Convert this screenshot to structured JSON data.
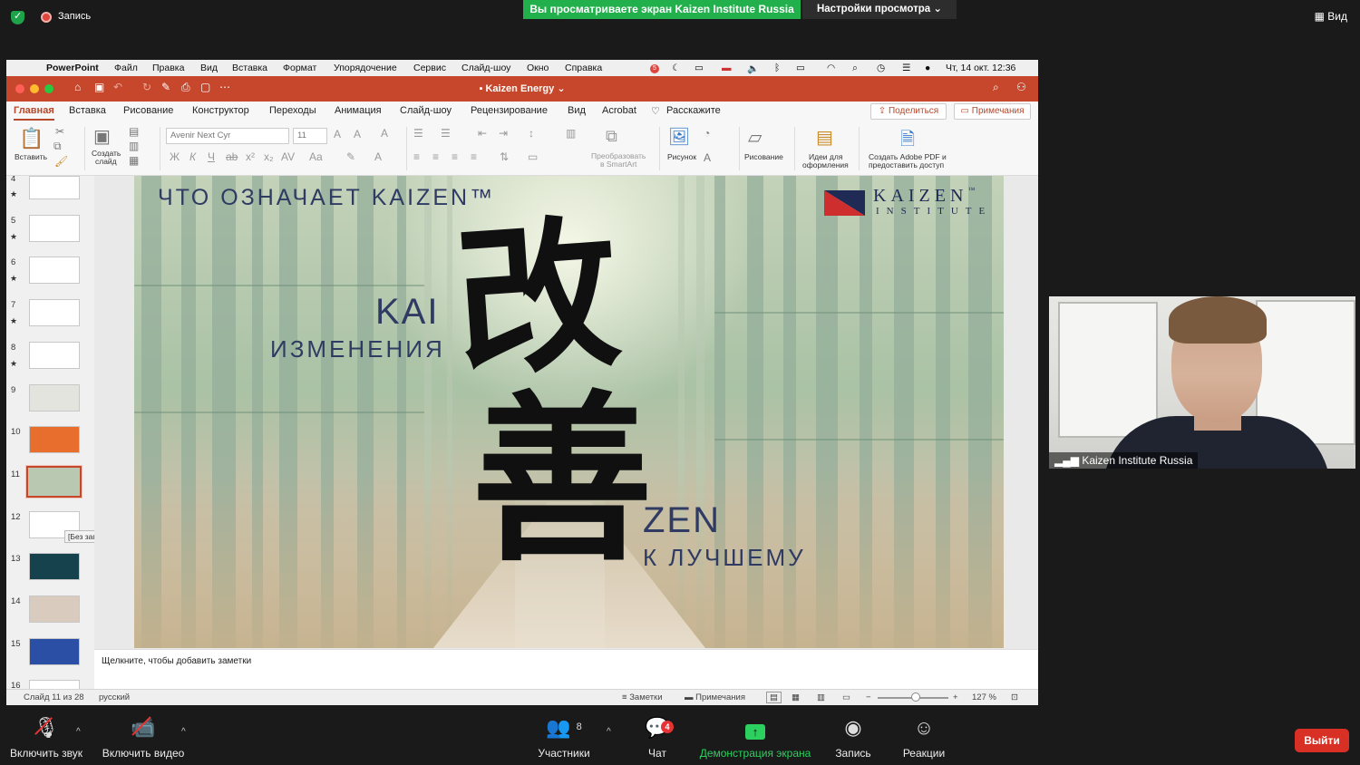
{
  "zoom_top": {
    "recording_label": "Запись",
    "viewing_banner": "Вы просматриваете экран Kaizen Institute Russia",
    "view_settings": "Настройки просмотра",
    "view_label": "Вид"
  },
  "mac_menu": {
    "app": "PowerPoint",
    "items": [
      "Файл",
      "Правка",
      "Вид",
      "Вставка",
      "Формат",
      "Упорядочение",
      "Сервис",
      "Слайд-шоу",
      "Окно",
      "Справка"
    ],
    "notif_count": "5",
    "datetime": "Чт, 14 окт.  12:36"
  },
  "ppt": {
    "doc_title": "Kaizen Energy",
    "tabs": [
      "Главная",
      "Вставка",
      "Рисование",
      "Конструктор",
      "Переходы",
      "Анимация",
      "Слайд-шоу",
      "Рецензирование",
      "Вид",
      "Acrobat",
      "Расскажите"
    ],
    "share_btn": "Поделиться",
    "comments_btn": "Примечания",
    "ribbon": {
      "paste": "Вставить",
      "new_slide_1": "Создать",
      "new_slide_2": "слайд",
      "font": "Avenir Next Cyr",
      "size": "11",
      "smartart_1": "Преобразовать",
      "smartart_2": "в SmartArt",
      "picture": "Рисунок",
      "drawing": "Рисование",
      "ideas_1": "Идеи для",
      "ideas_2": "оформления",
      "adobe_1": "Создать Adobe PDF и",
      "adobe_2": "предоставить доступ"
    },
    "thumbnails": [
      "4",
      "5",
      "6",
      "7",
      "8",
      "9",
      "10",
      "11",
      "12",
      "13",
      "14",
      "15",
      "16"
    ],
    "tooltip": "[Без заголовка]",
    "slide": {
      "title": "ЧТО ОЗНАЧАЕТ KAIZEN™",
      "logo_word": "KAIZEN",
      "logo_tm": "™",
      "logo_sub": "INSTITUTE",
      "kai": "KAI",
      "kai_meaning": "ИЗМЕНЕНИЯ",
      "zen": "ZEN",
      "zen_meaning": "К ЛУЧШЕМУ",
      "kanji_1": "改",
      "kanji_2": "善"
    },
    "notes_placeholder": "Щелкните, чтобы добавить заметки",
    "status": {
      "slide_of": "Слайд 11 из 28",
      "language": "русский",
      "notes": "Заметки",
      "comments": "Примечания",
      "zoom": "127 %"
    }
  },
  "camera": {
    "participant_name": "Kaizen Institute Russia"
  },
  "zoom_bottom": {
    "mute": "Включить звук",
    "video": "Включить видео",
    "participants": "Участники",
    "participants_count": "8",
    "chat": "Чат",
    "chat_badge": "4",
    "share": "Демонстрация экрана",
    "record": "Запись",
    "reactions": "Реакции",
    "leave": "Выйти"
  }
}
